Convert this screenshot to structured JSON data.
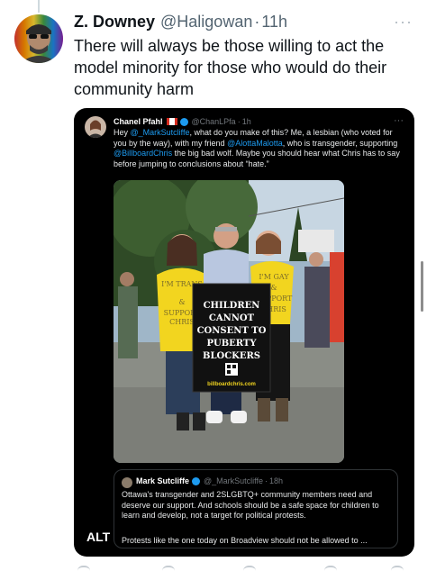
{
  "tweet": {
    "display_name": "Z. Downey",
    "handle": "@Haligowan",
    "sep": "·",
    "time": "11h",
    "more": "···",
    "text": "There will always be those willing to act the model minority for those who would do their community harm"
  },
  "quoted": {
    "display_name": "Chanel Pfahl",
    "handle": "@ChanLPfa",
    "sep": "·",
    "time": "1h",
    "more": "···",
    "text": {
      "p1": "Hey ",
      "m1": "@_MarkSutcliffe",
      "p2": ", what do you make of this? Me, a lesbian (who voted for you by the way), with my friend ",
      "m2": "@AlottaMalotta",
      "p3": ", who is transgender, supporting ",
      "m3": "@BillboardChris",
      "p4": " the big bad wolf. Maybe you should hear what Chris has to say before jumping to conclusions about “hate.”"
    },
    "photo": {
      "sign_line1": "CHILDREN",
      "sign_line2": "CANNOT",
      "sign_line3": "CONSENT TO",
      "sign_line4": "PUBERTY",
      "sign_line5": "BLOCKERS",
      "sign_url": "billboardchris.com",
      "shirt_left": "I'M TRANS & I SUPPORT CHRIS",
      "shirt_right": "I'M GAY & I SUPPORT CHRIS"
    },
    "alt_badge": "ALT"
  },
  "nested": {
    "display_name": "Mark Sutcliffe",
    "handle": "@_MarkSutcliffe",
    "sep": "·",
    "time": "18h",
    "text": "Ottawa's transgender and 2SLGBTQ+ community members need and deserve our support. And schools should be a safe space for children to learn and develop, not a target for political protests.",
    "text2": "Protests like the one today on Broadview should not be allowed to ..."
  },
  "colors": {
    "accent": "#1d9bf0",
    "shirt_yellow": "#f2d51f",
    "sign_black": "#111111"
  }
}
